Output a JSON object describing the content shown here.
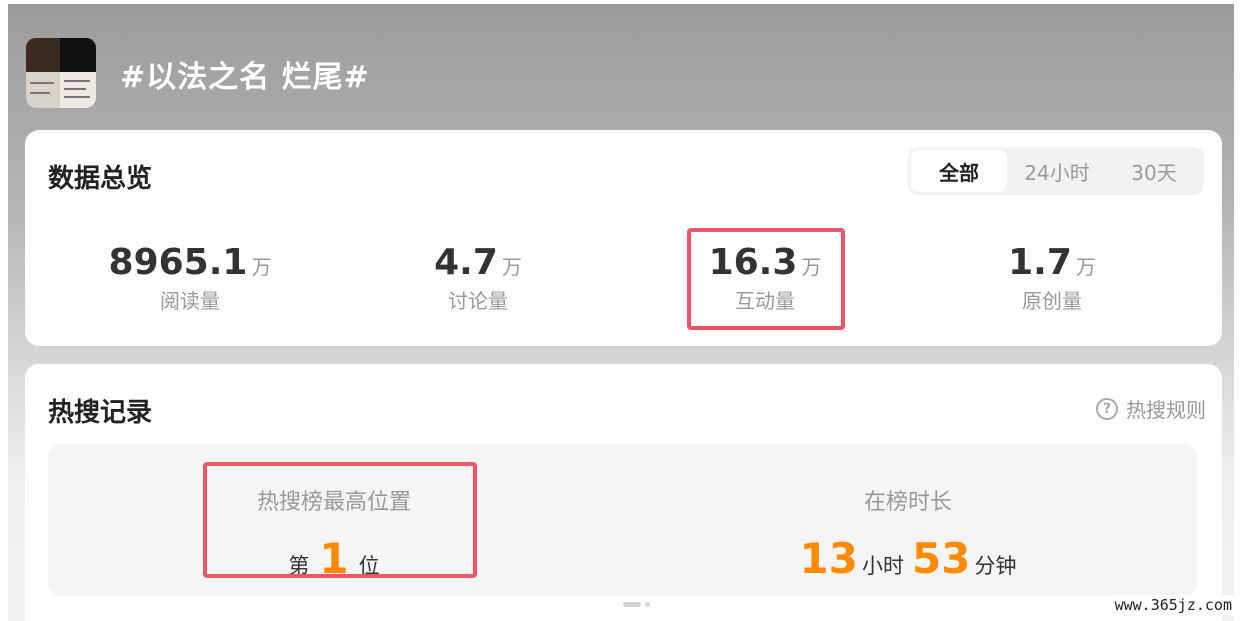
{
  "topic": {
    "title": "#以法之名 烂尾#",
    "thumbnail_icon": "topic-cover-image"
  },
  "overview": {
    "title": "数据总览",
    "tabs": [
      {
        "label": "全部",
        "active": true
      },
      {
        "label": "24小时",
        "active": false
      },
      {
        "label": "30天",
        "active": false
      }
    ],
    "stats": [
      {
        "value": "8965.1",
        "unit": "万",
        "label": "阅读量"
      },
      {
        "value": "4.7",
        "unit": "万",
        "label": "讨论量"
      },
      {
        "value": "16.3",
        "unit": "万",
        "label": "互动量",
        "highlighted": true
      },
      {
        "value": "1.7",
        "unit": "万",
        "label": "原创量"
      }
    ]
  },
  "hot_search": {
    "title": "热搜记录",
    "rules_label": "热搜规则",
    "rules_icon": "help-circle-icon",
    "best_rank": {
      "label": "热搜榜最高位置",
      "prefix": "第",
      "value": "1",
      "suffix": "位",
      "highlighted": true
    },
    "duration": {
      "label": "在榜时长",
      "hours": "13",
      "hours_unit": "小时",
      "minutes": "53",
      "minutes_unit": "分钟"
    }
  },
  "watermark": "www.365jz.com",
  "colors": {
    "accent_orange": "#ff8a00",
    "highlight_red": "#ef5468"
  }
}
